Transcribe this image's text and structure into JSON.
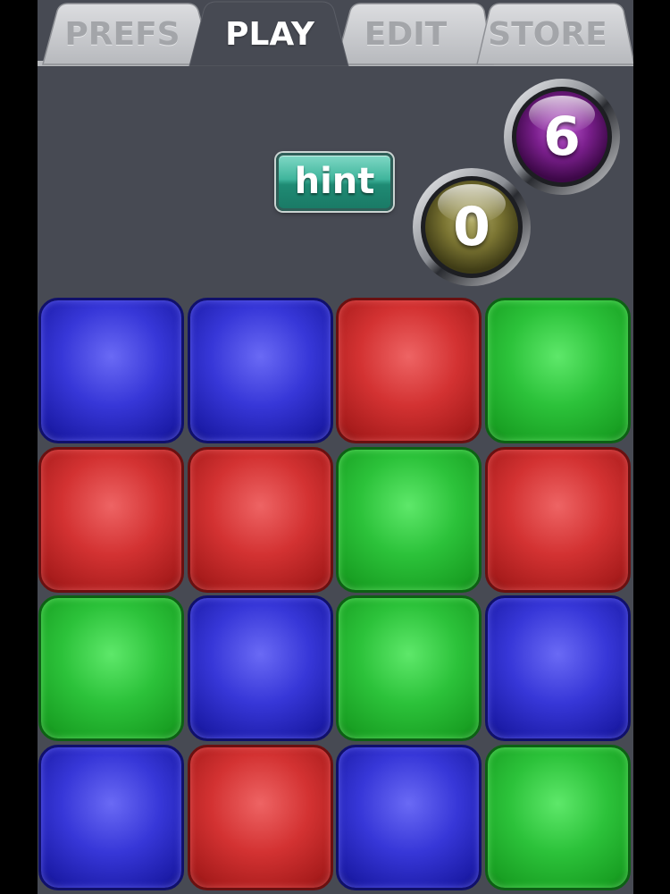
{
  "tabs": [
    {
      "label": "PREFS",
      "active": false
    },
    {
      "label": "PLAY",
      "active": true
    },
    {
      "label": "EDIT",
      "active": false
    },
    {
      "label": "STORE",
      "active": false
    }
  ],
  "hint_button": {
    "label": "hint"
  },
  "counters": {
    "purple": {
      "value": "6",
      "color": "#7a1f8c"
    },
    "olive": {
      "value": "0",
      "color": "#7a7432"
    }
  },
  "board": {
    "rows": 4,
    "cols": 4,
    "tiles": [
      [
        "blue",
        "blue",
        "red",
        "green"
      ],
      [
        "red",
        "red",
        "green",
        "red"
      ],
      [
        "green",
        "blue",
        "green",
        "blue"
      ],
      [
        "blue",
        "red",
        "blue",
        "green"
      ]
    ]
  },
  "colors": {
    "background": "#474a53",
    "tab_inactive": "#c4c6c9",
    "tab_active": "#474a53",
    "tile_blue": "#3737d8",
    "tile_red": "#d33232",
    "tile_green": "#2cc23a",
    "hint_teal": "#2ea088"
  }
}
